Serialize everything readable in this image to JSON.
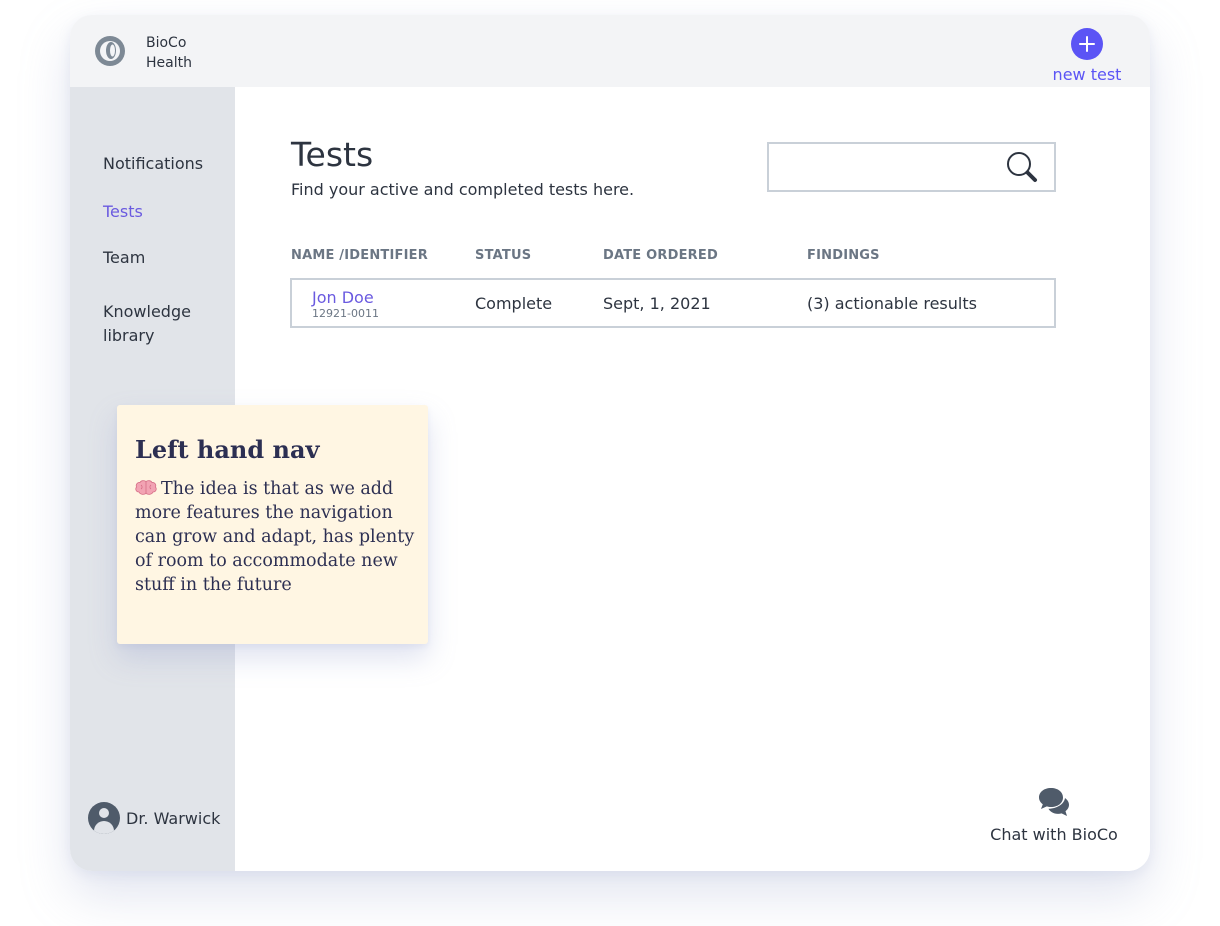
{
  "brand": {
    "line1": "BioCo",
    "line2": "Health"
  },
  "header": {
    "new_test_label": "new test"
  },
  "sidebar": {
    "items": [
      {
        "label": "Notifications"
      },
      {
        "label": "Tests"
      },
      {
        "label": "Team"
      },
      {
        "label": "Knowledge library"
      }
    ],
    "active_item": "Tests",
    "user_name": "Dr. Warwick"
  },
  "main": {
    "title": "Tests",
    "subtitle": "Find your active and completed tests here.",
    "search": {
      "value": "",
      "placeholder": ""
    },
    "table": {
      "columns": [
        "NAME /IDENTIFIER",
        "STATUS",
        "DATE ORDERED",
        "FINDINGS"
      ],
      "rows": [
        {
          "name": "Jon Doe",
          "identifier": "12921-0011",
          "status": "Complete",
          "date_ordered": "Sept, 1, 2021",
          "findings": "(3) actionable results"
        }
      ]
    }
  },
  "chat": {
    "label": "Chat with BioCo"
  },
  "note": {
    "title": "Left hand nav",
    "body": "The idea is that as we add more features the navigation can grow and adapt, has plenty of room to accommodate new stuff in the future",
    "icon": "brain-icon"
  },
  "colors": {
    "accent": "#5b54f5",
    "active_nav": "#6a5ae0",
    "sidebar_bg": "#e1e4e9",
    "topbar_bg": "#f3f4f6",
    "note_bg": "#fff6e3"
  }
}
